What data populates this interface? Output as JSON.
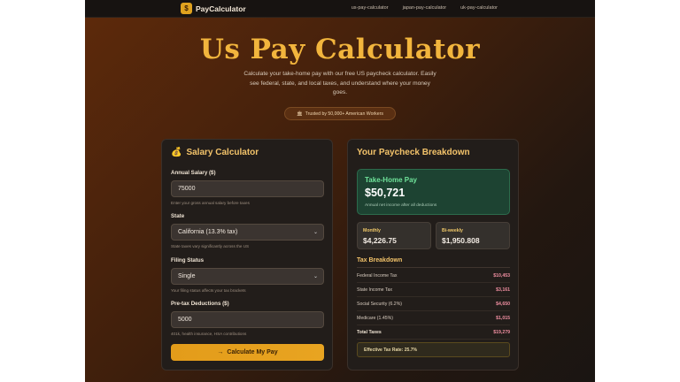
{
  "brand": {
    "logo_glyph": "$",
    "name": "PayCalculator"
  },
  "nav": [
    "us-pay-calculator",
    "japan-pay-calculator",
    "uk-pay-calculator"
  ],
  "hero": {
    "title": "Us Pay Calculator",
    "subtitle": "Calculate your take-home pay with our free US paycheck calculator. Easily see federal, state, and local taxes, and understand where your money goes.",
    "trust_badge": "Trusted by 50,000+ American Workers",
    "trust_icon": "🏛"
  },
  "salary_form": {
    "title": "Salary Calculator",
    "title_icon": "💰",
    "annual_salary_label": "Annual Salary ($)",
    "annual_salary_value": "75000",
    "annual_salary_hint": "Enter your gross annual salary before taxes",
    "state_label": "State",
    "state_value": "California (13.3% tax)",
    "state_hint": "State taxes vary significantly across the US",
    "filing_label": "Filing Status",
    "filing_value": "Single",
    "filing_hint": "Your filing status affects your tax brackets",
    "pretax_label": "Pre-tax Deductions ($)",
    "pretax_value": "5000",
    "pretax_hint": "401k, health insurance, HSA contributions",
    "button_label": "Calculate My Pay",
    "button_icon": "→"
  },
  "breakdown": {
    "title": "Your Paycheck Breakdown",
    "takehome_label": "Take-Home Pay",
    "takehome_value": "$50,721",
    "takehome_note": "Annual net income after all deductions",
    "monthly_label": "Monthly",
    "monthly_value": "$4,226.75",
    "biweekly_label": "Bi-weekly",
    "biweekly_value": "$1,950.808",
    "tax_title": "Tax Breakdown",
    "taxes": [
      {
        "label": "Federal Income Tax",
        "value": "$10,453"
      },
      {
        "label": "State Income Tax",
        "value": "$3,161"
      },
      {
        "label": "Social Security (6.2%)",
        "value": "$4,650"
      },
      {
        "label": "Medicare (1.45%)",
        "value": "$1,015"
      },
      {
        "label": "Total Taxes",
        "value": "$19,279"
      }
    ],
    "effective_rate": "Effective Tax Rate: 25.7%"
  },
  "colors": {
    "accent": "#f2b53d",
    "takehome_bg": "#1d4332",
    "tax_value": "#ef8ea0",
    "button": "#e39c1a"
  }
}
